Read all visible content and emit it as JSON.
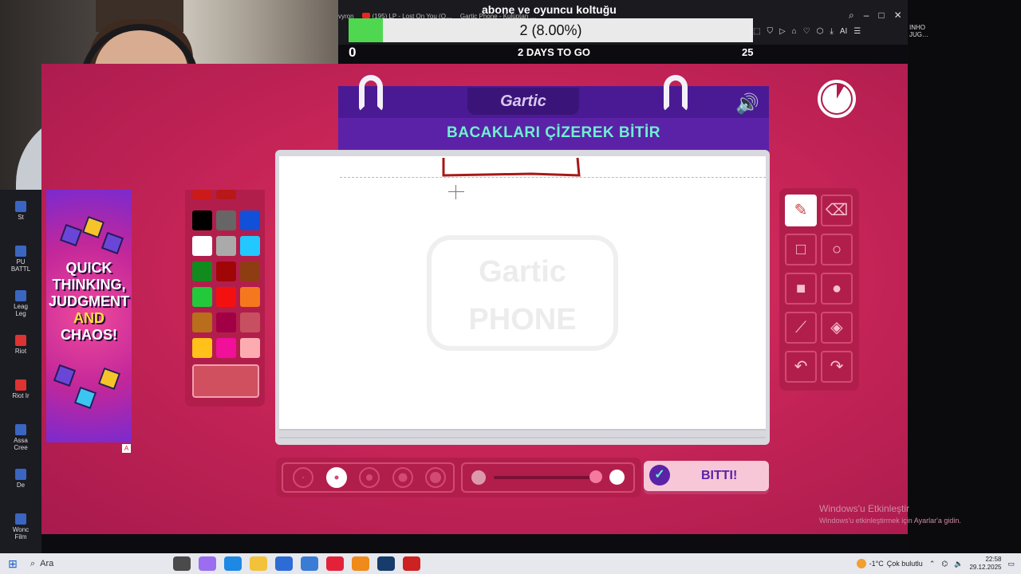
{
  "stream": {
    "title": "abone ve oyuncu koltuğu",
    "browser_tabs": [
      "vyron",
      "(195) LP - Lost On You (O…",
      "Gartic Phone - Kulüptan …"
    ],
    "side_text": "INHO\nJUG…"
  },
  "progress": {
    "label": "2 (8.00%)",
    "fraction": 0.08,
    "left_value": "0",
    "middle_text": "2 DAYS TO GO",
    "right_value": "25"
  },
  "desktop_icons": [
    {
      "label": "St",
      "icon": "steam-icon"
    },
    {
      "label": "PU\nBATTL",
      "icon": "pubg-icon"
    },
    {
      "label": "Leag\nLeg",
      "icon": "league-icon"
    },
    {
      "label": "Riot",
      "icon": "riot-icon"
    },
    {
      "label": "Riot Ir",
      "icon": "riot-icon"
    },
    {
      "label": "Assa\nCree",
      "icon": "assassins-creed-icon"
    },
    {
      "label": "De",
      "icon": "app-icon"
    },
    {
      "label": "Wonc\nFilm",
      "icon": "app-icon"
    }
  ],
  "ad": {
    "line1": "QUICK",
    "line2": "THINKING,",
    "line3": "JUDGMENT",
    "line4": "AND",
    "line5": "CHAOS!",
    "badge": "A"
  },
  "palette": {
    "colors": [
      "#000000",
      "#666666",
      "#1150d8",
      "#ffffff",
      "#aaaaaa",
      "#22c8ff",
      "#118a1e",
      "#a00606",
      "#8e3d12",
      "#22c93a",
      "#f51010",
      "#f5781f",
      "#b86e1a",
      "#a20045",
      "#c75060",
      "#ffc11a",
      "#f0109a",
      "#fcacb0"
    ],
    "current": "#d05060"
  },
  "game": {
    "logo": "Gartic",
    "prompt": "BACAKLARI ÇİZEREK BİTİR",
    "watermark_line1": "Gartic",
    "watermark_line2": "PHONE",
    "done_label": "BITTI!"
  },
  "tools": [
    {
      "name": "pencil",
      "icon": "✎",
      "active": true
    },
    {
      "name": "eraser",
      "icon": "⌫",
      "active": false
    },
    {
      "name": "rectangle-outline",
      "icon": "□",
      "active": false
    },
    {
      "name": "ellipse-outline",
      "icon": "○",
      "active": false
    },
    {
      "name": "rectangle-filled",
      "icon": "■",
      "active": false
    },
    {
      "name": "ellipse-filled",
      "icon": "●",
      "active": false
    },
    {
      "name": "line",
      "icon": "⟋",
      "active": false
    },
    {
      "name": "fill-bucket",
      "icon": "◈",
      "active": false
    },
    {
      "name": "undo",
      "icon": "↶",
      "active": false
    },
    {
      "name": "redo",
      "icon": "↷",
      "active": false
    }
  ],
  "brush_sizes": {
    "count": 5,
    "selected_index": 1
  },
  "windows": {
    "activate_title": "Windows'u Etkinleştir",
    "activate_sub": "Windows'u etkinleştirmek için Ayarlar'a gidin."
  },
  "taskbar": {
    "search_placeholder": "Ara",
    "temperature": "-1°C",
    "weather": "Çok bulutlu",
    "time": "22:58",
    "date": "29.12.2025"
  }
}
